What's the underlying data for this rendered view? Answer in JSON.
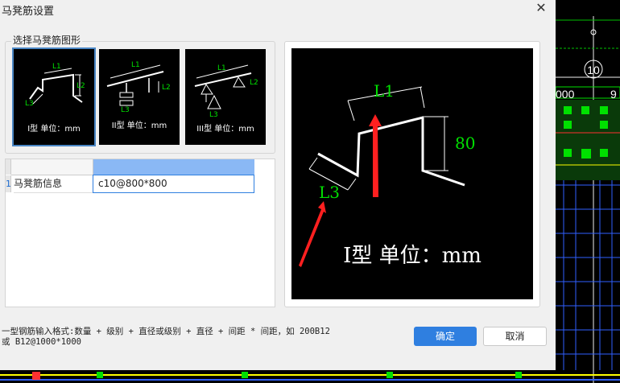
{
  "window": {
    "title": "马凳筋设置",
    "close_label": "✕"
  },
  "shape_group": {
    "label": "选择马凳筋图形",
    "options": [
      {
        "caption": "I型 单位：mm",
        "labels": [
          "L1",
          "L2",
          "L3"
        ],
        "selected": true
      },
      {
        "caption": "II型 单位：mm",
        "labels": [
          "L1",
          "L2",
          "L3"
        ],
        "selected": false
      },
      {
        "caption": "III型 单位：mm",
        "labels": [
          "L1",
          "L2",
          "L3"
        ],
        "selected": false
      }
    ]
  },
  "grid": {
    "rows": [
      {
        "index": "1",
        "name": "马凳筋信息",
        "value": "c10@800*800"
      }
    ]
  },
  "preview": {
    "label_l1": "L1",
    "label_l2": "80",
    "label_l3": "L3",
    "caption": "I型 单位：mm"
  },
  "hint": {
    "line1": "一型钢筋输入格式:数量 + 级别 + 直径或级别 + 直径 + 间距 * 间距，如 200B12",
    "line2": "或 B12@1000*1000"
  },
  "buttons": {
    "ok": "确定",
    "cancel": "取消"
  },
  "background": {
    "axis_label": "10",
    "dim_left": "000",
    "dim_right": "9"
  },
  "colors": {
    "accent": "#2f7fe0",
    "cad_green": "#00e000",
    "cad_yellow": "#ffff00",
    "arrow_red": "#ff2020"
  }
}
